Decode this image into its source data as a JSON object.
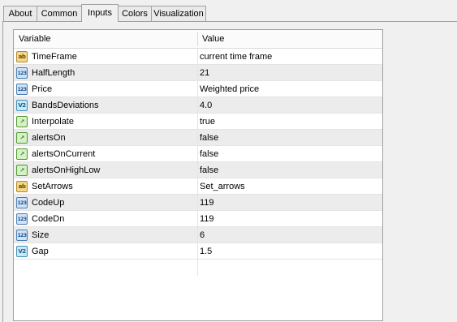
{
  "tabs": [
    {
      "label": "About"
    },
    {
      "label": "Common"
    },
    {
      "label": "Inputs"
    },
    {
      "label": "Colors"
    },
    {
      "label": "Visualization"
    }
  ],
  "active_tab": "Inputs",
  "table": {
    "headers": {
      "variable": "Variable",
      "value": "Value"
    },
    "rows": [
      {
        "icon": "ab",
        "name": "TimeFrame",
        "value": "current time frame"
      },
      {
        "icon": "123",
        "name": "HalfLength",
        "value": "21"
      },
      {
        "icon": "123",
        "name": "Price",
        "value": "Weighted price"
      },
      {
        "icon": "v2",
        "name": "BandsDeviations",
        "value": "4.0"
      },
      {
        "icon": "bool",
        "name": "Interpolate",
        "value": "true"
      },
      {
        "icon": "bool",
        "name": "alertsOn",
        "value": "false"
      },
      {
        "icon": "bool",
        "name": "alertsOnCurrent",
        "value": "false"
      },
      {
        "icon": "bool",
        "name": "alertsOnHighLow",
        "value": "false"
      },
      {
        "icon": "ab",
        "name": "SetArrows",
        "value": "Set_arrows"
      },
      {
        "icon": "123",
        "name": "CodeUp",
        "value": "119"
      },
      {
        "icon": "123",
        "name": "CodeDn",
        "value": "119"
      },
      {
        "icon": "123",
        "name": "Size",
        "value": "6"
      },
      {
        "icon": "v2",
        "name": "Gap",
        "value": "1.5"
      }
    ]
  },
  "icon_types": {
    "ab": "string-type-icon",
    "123": "integer-type-icon",
    "v2": "double-type-icon",
    "bool": "boolean-type-icon"
  }
}
